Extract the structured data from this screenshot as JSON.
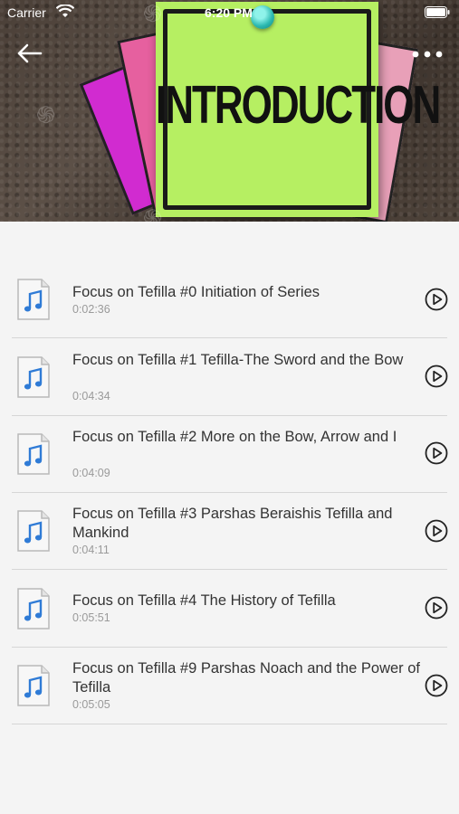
{
  "status_bar": {
    "carrier": "Carrier",
    "time": "6:20 PM"
  },
  "hero": {
    "image_text": "INTRODUCTION"
  },
  "icons": {
    "back": "back-arrow-icon",
    "more": "more-dots-icon",
    "file": "audio-file-icon",
    "play": "play-circle-icon"
  },
  "colors": {
    "accent_note": "#b6ef62",
    "icon_blue": "#2f7bd6",
    "divider": "#d6d6d6"
  },
  "tracks": [
    {
      "title": "Focus on Tefilla #0 Initiation of Series",
      "duration": "0:02:36"
    },
    {
      "title": "Focus on Tefilla #1 Tefilla-The Sword and the Bow",
      "duration": "0:04:34"
    },
    {
      "title": "Focus on Tefilla #2 More on the Bow, Arrow and I",
      "duration": "0:04:09"
    },
    {
      "title": "Focus on Tefilla #3 Parshas Beraishis Tefilla and Mankind",
      "duration": "0:04:11"
    },
    {
      "title": "Focus on Tefilla #4 The History of Tefilla",
      "duration": "0:05:51"
    },
    {
      "title": "Focus on Tefilla #9 Parshas Noach and the Power of Tefilla",
      "duration": "0:05:05"
    }
  ]
}
